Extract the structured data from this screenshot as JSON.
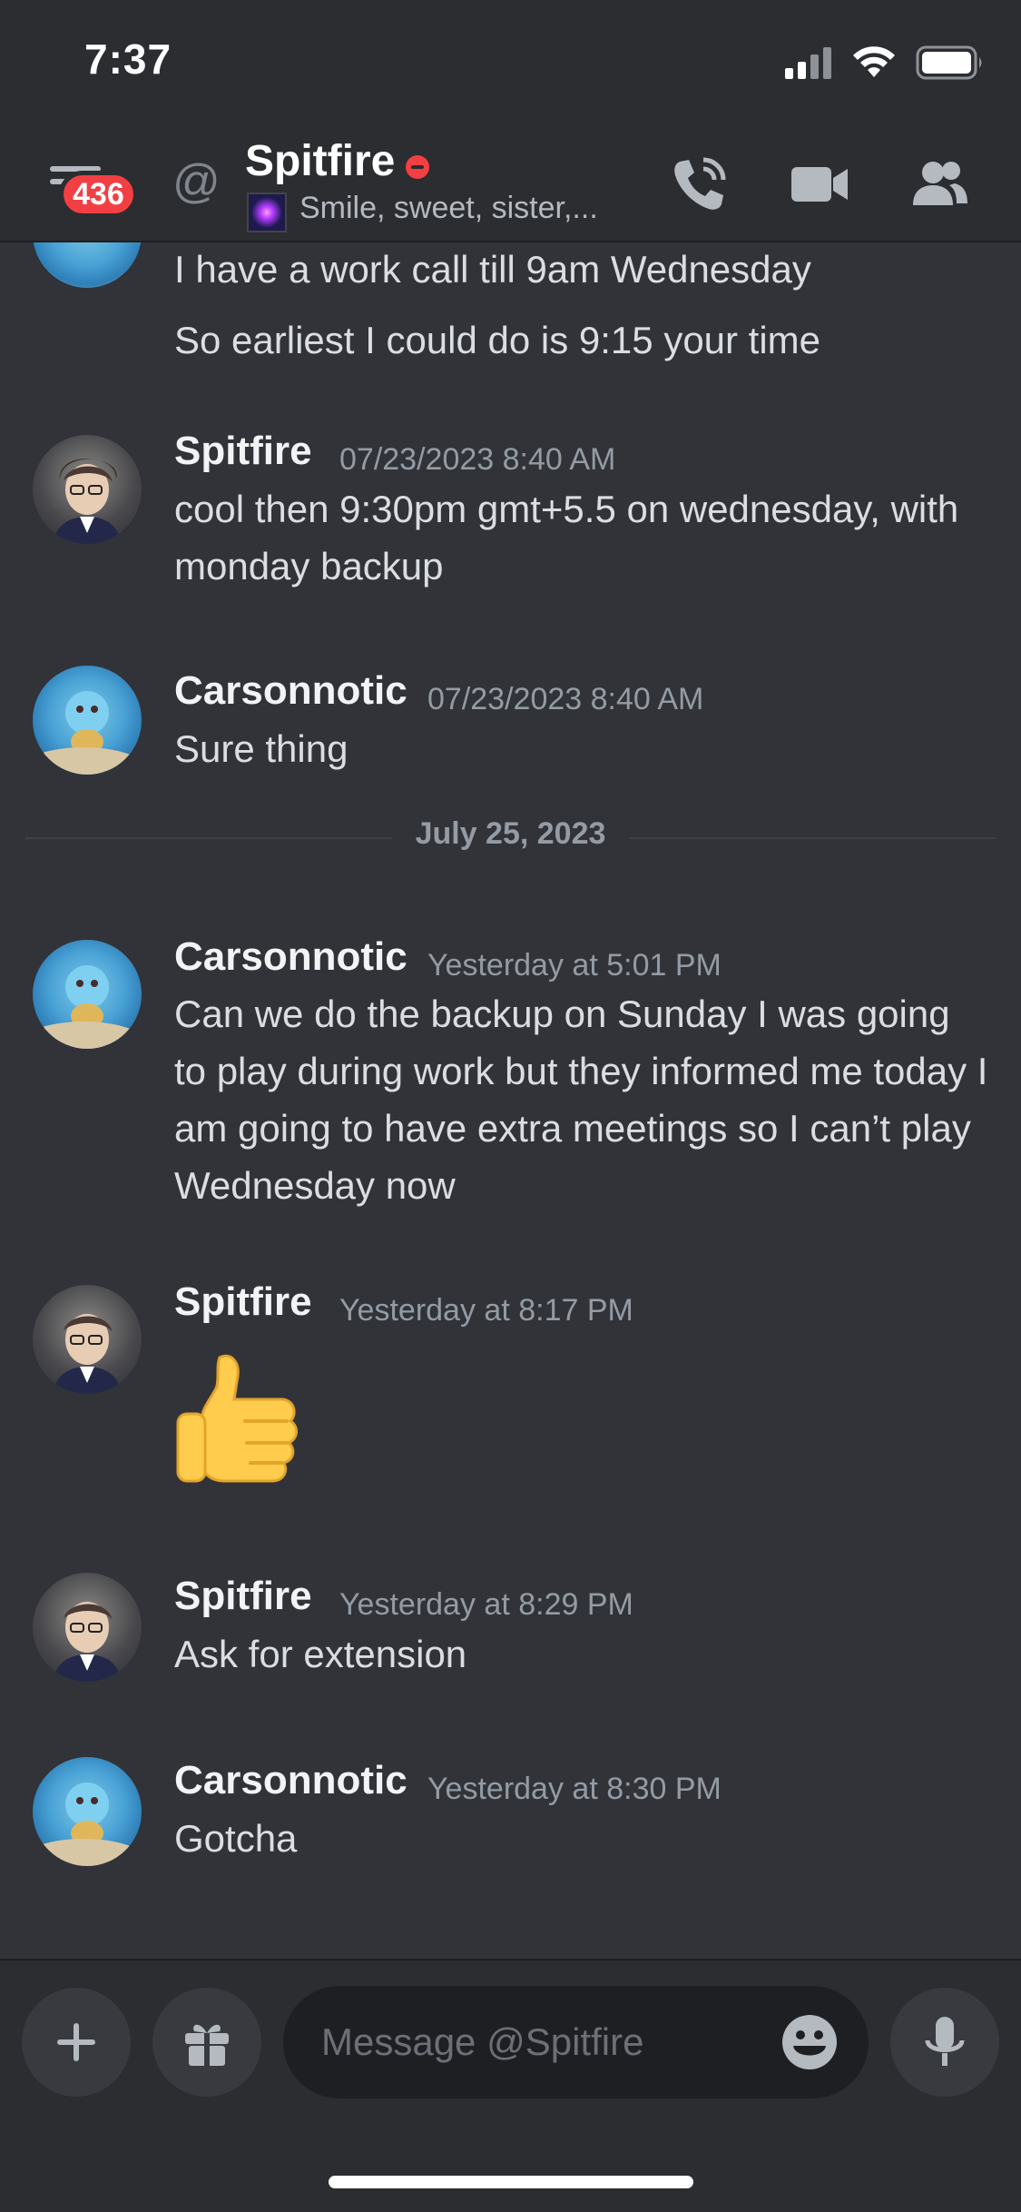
{
  "status_bar": {
    "time": "7:37",
    "icons": [
      "cellular-signal-icon",
      "wifi-icon",
      "battery-icon"
    ]
  },
  "header": {
    "unread_badge": "436",
    "dm_icon": "at-icon",
    "name": "Spitfire",
    "presence": "do-not-disturb",
    "status_text": "Smile, sweet, sister,...",
    "actions": [
      "voice-call-icon",
      "video-call-icon",
      "members-icon"
    ]
  },
  "messages": [
    {
      "continued": true,
      "lines": [
        "I have a work call till 9am Wednesday",
        "So earliest I could do is 9:15 your time"
      ]
    },
    {
      "author": "Spitfire",
      "time": "07/23/2023 8:40 AM",
      "text": "cool then 9:30pm gmt+5.5 on wednesday, with monday backup"
    },
    {
      "author": "Carsonnotic",
      "time": "07/23/2023 8:40 AM",
      "text": "Sure thing"
    },
    {
      "author": "Carsonnotic",
      "time": "Yesterday at 5:01 PM",
      "text": "Can we do the backup on Sunday I was going to play during work but they informed me today I am going to have extra meetings so I can’t play Wednesday now"
    },
    {
      "author": "Spitfire",
      "time": "Yesterday at 8:17 PM",
      "emoji": "thumbs-up"
    },
    {
      "author": "Spitfire",
      "time": "Yesterday at 8:29 PM",
      "text": "Ask for extension"
    },
    {
      "author": "Carsonnotic",
      "time": "Yesterday at 8:30 PM",
      "text": "Gotcha"
    }
  ],
  "date_divider": "July 25, 2023",
  "composer": {
    "placeholder": "Message @Spitfire",
    "buttons": [
      "plus-icon",
      "gift-icon",
      "emoji-icon",
      "microphone-icon"
    ]
  },
  "colors": {
    "background": "#313338",
    "header": "#2b2d31",
    "badge": "#f23f43",
    "text": "#dbdee1",
    "muted": "#949ba4"
  }
}
